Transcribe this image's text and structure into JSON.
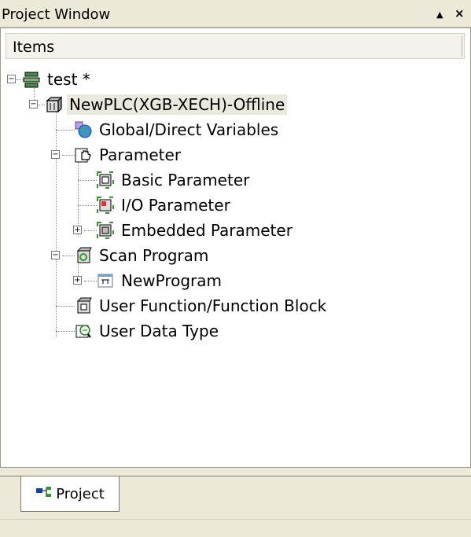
{
  "window": {
    "title": "Project Window",
    "pin_label": "▲",
    "close_label": "×"
  },
  "header": {
    "column": "Items"
  },
  "tree": {
    "root": {
      "label": "test *"
    },
    "plc": {
      "label": "NewPLC(XGB-XECH)-Offline"
    },
    "global_vars": {
      "label": "Global/Direct Variables"
    },
    "parameter": {
      "label": "Parameter"
    },
    "basic_param": {
      "label": "Basic Parameter"
    },
    "io_param": {
      "label": "I/O Parameter"
    },
    "embedded_param": {
      "label": "Embedded Parameter"
    },
    "scan_program": {
      "label": "Scan Program"
    },
    "new_program": {
      "label": "NewProgram"
    },
    "user_function": {
      "label": "User Function/Function Block"
    },
    "user_data_type": {
      "label": "User Data Type"
    }
  },
  "tabs": {
    "project": "Project"
  },
  "colors": {
    "accent_green": "#2e9a2e",
    "selection": "#ebe8de"
  }
}
